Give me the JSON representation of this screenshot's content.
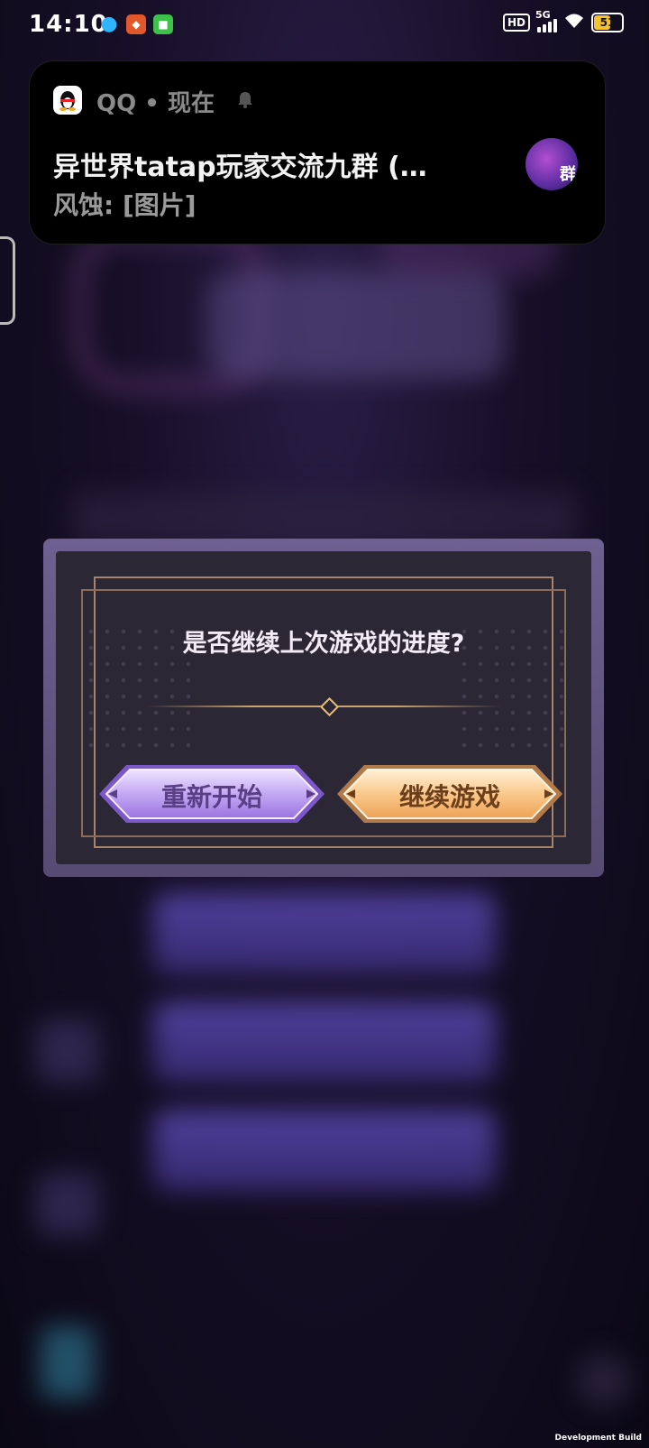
{
  "status_bar": {
    "time": "14:10",
    "hd": "HD",
    "network": "5G",
    "battery": "51"
  },
  "notification": {
    "app": "QQ",
    "separator": "•",
    "when": "现在",
    "title": "异世界tatap玩家交流九群 (…",
    "body": "风蚀: [图片]",
    "avatar_badge": "群"
  },
  "dialog": {
    "question": "是否继续上次游戏的进度?",
    "restart_label": "重新开始",
    "continue_label": "继续游戏"
  },
  "footer": {
    "build_label": "Development Build"
  },
  "colors": {
    "restart_button": "#c8b0f5",
    "continue_button": "#f6c68a",
    "dialog_frame": "#6e6090"
  }
}
